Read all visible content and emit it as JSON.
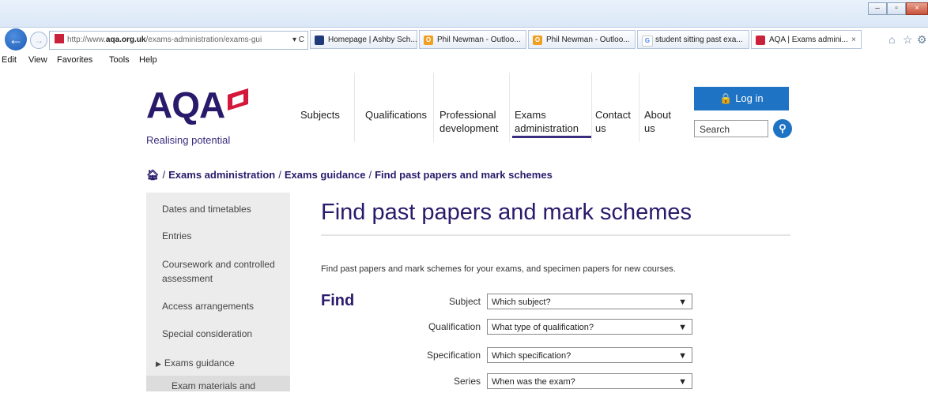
{
  "browser": {
    "address": {
      "prefix": "http://www.",
      "domain": "aqa.org.uk",
      "path": "/exams-administration/exams-gui",
      "controls": "▾ C"
    },
    "tabs": [
      {
        "label": "Homepage | Ashby Sch...",
        "icon_color": "#1f3a78"
      },
      {
        "label": "Phil Newman - Outloo...",
        "icon_color": "#f0a020"
      },
      {
        "label": "Phil Newman - Outloo...",
        "icon_color": "#f0a020"
      },
      {
        "label": "student sitting past exa...",
        "icon_color": "#4285f4"
      },
      {
        "label": "AQA | Exams admini...",
        "icon_color": "#c8233a",
        "close": "×"
      }
    ],
    "menu": [
      "Edit",
      "View",
      "Favorites",
      "Tools",
      "Help"
    ],
    "window_buttons": [
      "–",
      "▫",
      "×"
    ]
  },
  "site": {
    "logo": "AQA",
    "tagline": "Realising potential",
    "nav": [
      {
        "label": "Subjects"
      },
      {
        "label": "Qualifications"
      },
      {
        "label": "Professional development"
      },
      {
        "label": "Exams administration"
      },
      {
        "label": "Contact us"
      },
      {
        "label": "About us"
      }
    ],
    "login_label": "Log in",
    "search_placeholder": "Search",
    "brand_color": "#2a1a6b",
    "accent_color": "#1f73c4"
  },
  "breadcrumb": [
    "Exams administration",
    "Exams guidance",
    "Find past papers and mark schemes"
  ],
  "sidebar": {
    "items": [
      "Dates and timetables",
      "Entries",
      "Coursework and controlled assessment",
      "Access arrangements",
      "Special consideration",
      "Exams guidance",
      "Exam materials and"
    ]
  },
  "main": {
    "title": "Find past papers and mark schemes",
    "intro": "Find past papers and mark schemes for your exams, and specimen papers for new courses.",
    "find_label": "Find",
    "fields": [
      {
        "label": "Subject",
        "value": "Which subject?"
      },
      {
        "label": "Qualification",
        "value": "What type of qualification?"
      },
      {
        "label": "Specification",
        "value": "Which specification?"
      },
      {
        "label": "Series",
        "value": "When was the exam?"
      }
    ]
  }
}
